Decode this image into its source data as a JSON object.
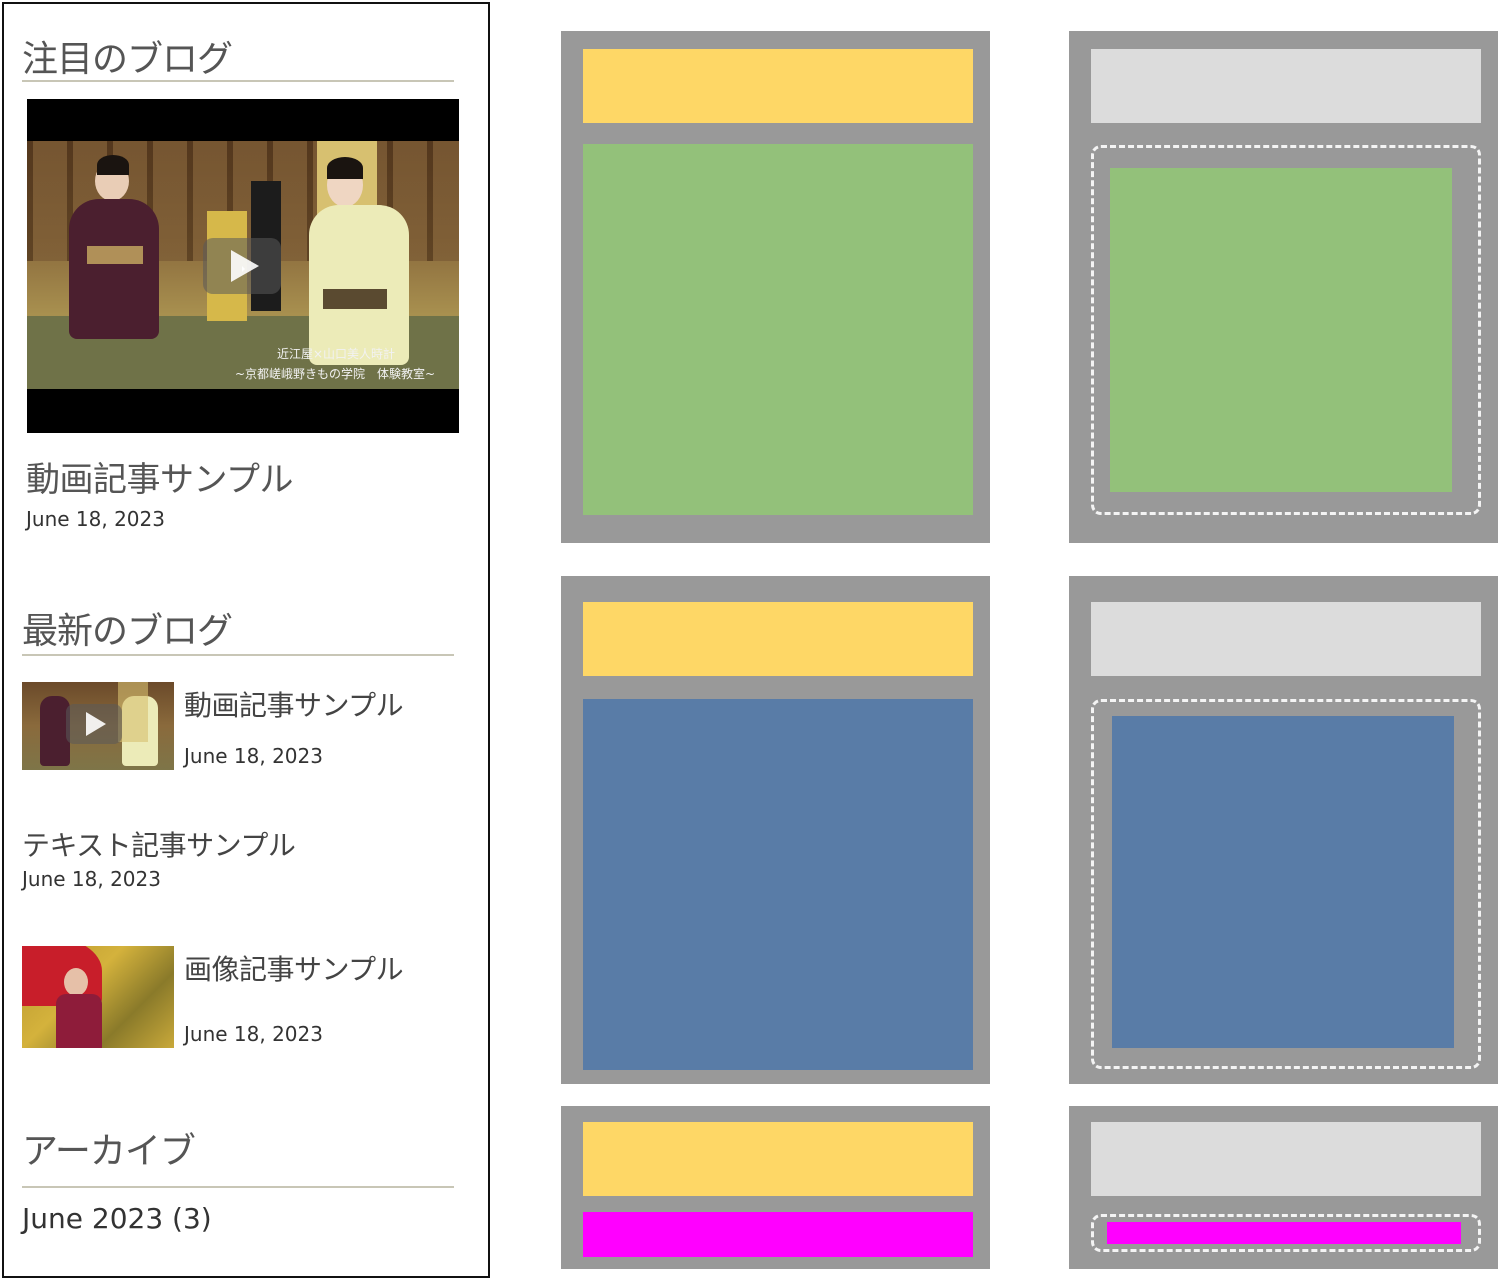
{
  "sidebar": {
    "featured": {
      "heading": "注目のブログ",
      "post": {
        "title": "動画記事サンプル",
        "date": "June 18, 2023",
        "thumb_caption_1": "近江屋×山口美人時計",
        "thumb_caption_2": "~京都嵯峨野きもの学院　体験教室~"
      }
    },
    "latest": {
      "heading": "最新のブログ",
      "posts": [
        {
          "title": "動画記事サンプル",
          "date": "June 18, 2023"
        },
        {
          "title": "テキスト記事サンプル",
          "date": "June 18, 2023"
        },
        {
          "title": "画像記事サンプル",
          "date": "June 18, 2023"
        }
      ]
    },
    "archive": {
      "heading": "アーカイブ",
      "items": [
        {
          "label": "June 2023 (3)"
        }
      ]
    }
  },
  "colors": {
    "frame": "#999999",
    "header_highlight": "#fed766",
    "header_plain": "#dcdcdc",
    "media": "#93c17a",
    "list": "#597ca7",
    "archive": "#ff00ff",
    "dashed_outline": "#f4f4f4"
  }
}
